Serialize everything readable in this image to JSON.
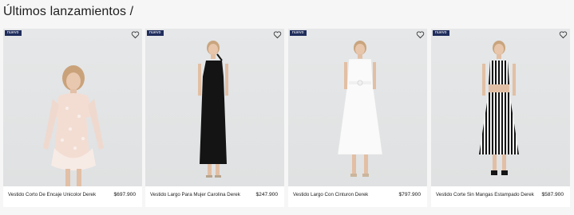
{
  "section": {
    "title": "Últimos lanzamientos /"
  },
  "colors": {
    "badge_bg": "#1f2d5c",
    "photo_bg": "#e3e5e6",
    "card_bg": "#ffffff"
  },
  "products": [
    {
      "badge": "nuevo",
      "name": "Vestido Corto De Encaje Unicolor Derek",
      "price": "$697.900",
      "fav_icon": "heart-outline-icon"
    },
    {
      "badge": "nuevo",
      "name": "Vestido Largo Para Mujer Carolina Derek",
      "price": "$247.900",
      "fav_icon": "heart-outline-icon"
    },
    {
      "badge": "nuevo",
      "name": "Vestido Largo Con Cinturon Derek",
      "price": "$797.900",
      "fav_icon": "heart-outline-icon"
    },
    {
      "badge": "nuevo",
      "name": "Vestido Corte Sin Mangas Estampado Derek",
      "price": "$587.900",
      "fav_icon": "heart-outline-icon"
    }
  ]
}
